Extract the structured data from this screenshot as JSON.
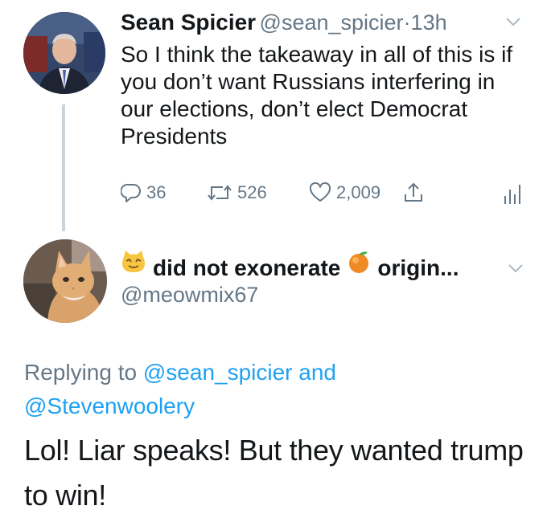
{
  "tweet1": {
    "name": "Sean Spicier",
    "handle": "@sean_spicier",
    "separator": "·",
    "time": "13h",
    "text": "So I think the takeaway in all of this is if you don’t want Russians interfering in our elections, don’t elect Democrat Presidents",
    "replies": "36",
    "retweets": "526",
    "likes": "2,009"
  },
  "tweet2": {
    "name_part1": "did not exonerate",
    "name_part2": "origin...",
    "handle": "@meowmix67",
    "replying_prefix": "Replying to",
    "mention1": "@sean_spicier",
    "replying_and": "and",
    "mention2": "@Stevenwoolery",
    "text": "Lol! Liar speaks! But they wanted trump to win!"
  },
  "colors": {
    "text": "#14171a",
    "secondary": "#657786",
    "link": "#1da1f2",
    "thread_line": "#c9d3db"
  },
  "icons": [
    "reply-icon",
    "retweet-icon",
    "like-icon",
    "share-icon",
    "analytics-icon",
    "chevron-down-icon",
    "cat-emoji-icon",
    "orange-emoji-icon"
  ]
}
